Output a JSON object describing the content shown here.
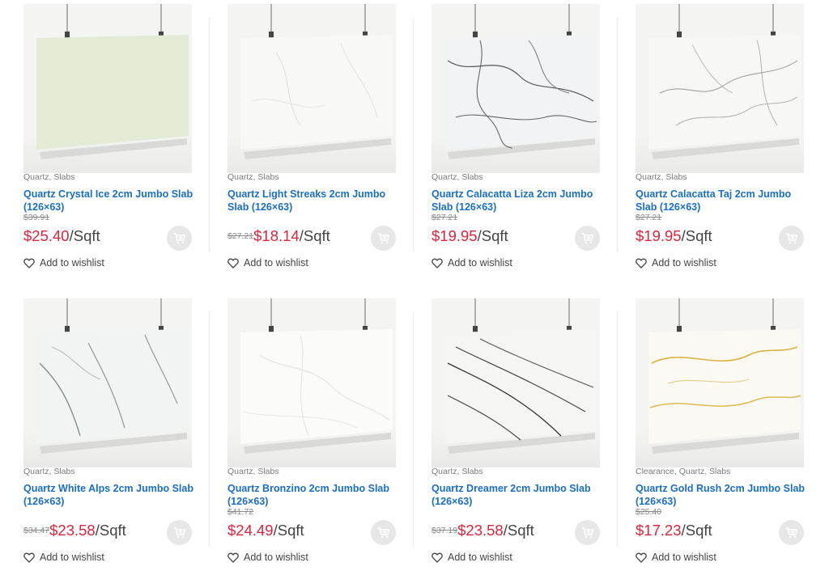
{
  "products": [
    {
      "categories": "Quartz, Slabs",
      "title": "Quartz Crystal Ice 2cm Jumbo Slab (126×63)",
      "old_price": "$39.91",
      "old_inline": "",
      "price": "$25.40",
      "unit": "/Sqft",
      "wishlist": "Add to wishlist"
    },
    {
      "categories": "Quartz, Slabs",
      "title": "Quartz Light Streaks 2cm Jumbo Slab (126×63)",
      "old_price": "",
      "old_inline": "$27.21",
      "price": "$18.14",
      "unit": "/Sqft",
      "wishlist": "Add to wishlist"
    },
    {
      "categories": "Quartz, Slabs",
      "title": "Quartz Calacatta Liza 2cm Jumbo Slab (126×63)",
      "old_price": "$27.21",
      "old_inline": "",
      "price": "$19.95",
      "unit": "/Sqft",
      "wishlist": "Add to wishlist"
    },
    {
      "categories": "Quartz, Slabs",
      "title": "Quartz Calacatta Taj 2cm Jumbo Slab (126×63)",
      "old_price": "$27.21",
      "old_inline": "",
      "price": "$19.95",
      "unit": "/Sqft",
      "wishlist": "Add to wishlist"
    },
    {
      "categories": "Quartz, Slabs",
      "title": "Quartz White Alps 2cm Jumbo Slab (126×63)",
      "old_price": "",
      "old_inline": "$34.47",
      "price": "$23.58",
      "unit": "/Sqft",
      "wishlist": "Add to wishlist"
    },
    {
      "categories": "Quartz, Slabs",
      "title": "Quartz Bronzino 2cm Jumbo Slab (126×63)",
      "old_price": "$41.72",
      "old_inline": "",
      "price": "$24.49",
      "unit": "/Sqft",
      "wishlist": "Add to wishlist"
    },
    {
      "categories": "Quartz, Slabs",
      "title": "Quartz Dreamer 2cm Jumbo Slab (126×63)",
      "old_price": "",
      "old_inline": "$37.19",
      "price": "$23.58",
      "unit": "/Sqft",
      "wishlist": "Add to wishlist"
    },
    {
      "categories": "Clearance, Quartz, Slabs",
      "title": "Quartz Gold Rush 2cm Jumbo Slab (126×63)",
      "old_price": "$25.40",
      "old_inline": "",
      "price": "$17.23",
      "unit": "/Sqft",
      "wishlist": "Add to wishlist"
    }
  ],
  "colors": {
    "link_blue": "#1a6fc4",
    "sale_red": "#e0243b",
    "muted_gray": "#7b7b7b",
    "cart_button_bg": "#e7e7e7"
  },
  "icons": {
    "cart": "cart-plus-icon",
    "wishlist": "heart-outline-icon"
  }
}
